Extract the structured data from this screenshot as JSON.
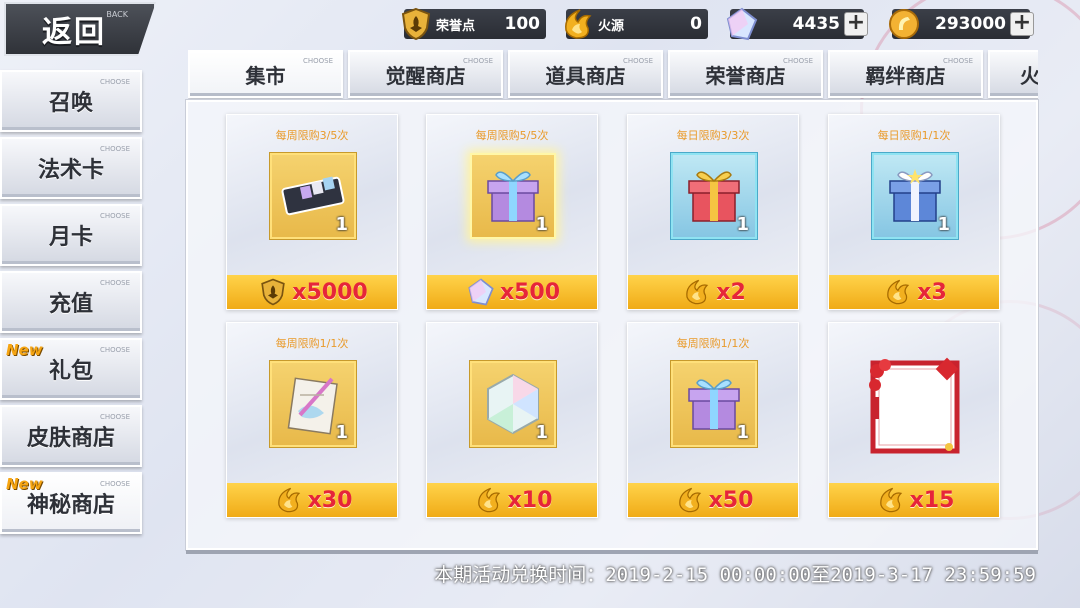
{
  "back": {
    "label": "返回",
    "sub": "BACK"
  },
  "currencies": [
    {
      "name": "荣誉点",
      "value": "100",
      "icon": "honor-badge-icon"
    },
    {
      "name": "火源",
      "value": "0",
      "icon": "fire-source-icon"
    },
    {
      "name": "",
      "value": "4435",
      "icon": "crystal-icon"
    },
    {
      "name": "",
      "value": "293000",
      "icon": "gold-coin-icon"
    }
  ],
  "sidebar": {
    "items": [
      {
        "label": "召唤",
        "tag": "CHOOSE",
        "badge": ""
      },
      {
        "label": "法术卡",
        "tag": "CHOOSE",
        "badge": ""
      },
      {
        "label": "月卡",
        "tag": "CHOOSE",
        "badge": ""
      },
      {
        "label": "充值",
        "tag": "CHOOSE",
        "badge": ""
      },
      {
        "label": "礼包",
        "tag": "CHOOSE",
        "badge": "New"
      },
      {
        "label": "皮肤商店",
        "tag": "CHOOSE",
        "badge": ""
      },
      {
        "label": "神秘商店",
        "tag": "CHOOSE",
        "badge": "New"
      }
    ]
  },
  "tabs": [
    {
      "label": "集市",
      "tag": "CHOOSE"
    },
    {
      "label": "觉醒商店",
      "tag": "CHOOSE"
    },
    {
      "label": "道具商店",
      "tag": "CHOOSE"
    },
    {
      "label": "荣誉商店",
      "tag": "CHOOSE"
    },
    {
      "label": "羁绊商店",
      "tag": "CHOOSE"
    },
    {
      "label": "火",
      "tag": ""
    }
  ],
  "items": [
    {
      "limit": "每周限购3/5次",
      "qty": "1",
      "price": "x5000",
      "currency": "honor-badge-icon",
      "icon": "card-pack-icon",
      "frame": "gold"
    },
    {
      "limit": "每周限购5/5次",
      "qty": "1",
      "price": "x500",
      "currency": "crystal-icon",
      "icon": "gift-box-purple-icon",
      "frame": "gold"
    },
    {
      "limit": "每日限购3/3次",
      "qty": "1",
      "price": "x2",
      "currency": "fire-source-icon",
      "icon": "gift-box-red-icon",
      "frame": "blue"
    },
    {
      "limit": "每日限购1/1次",
      "qty": "1",
      "price": "x3",
      "currency": "fire-source-icon",
      "icon": "gift-box-blue-icon",
      "frame": "blue"
    },
    {
      "limit": "每周限购1/1次",
      "qty": "1",
      "price": "x30",
      "currency": "fire-source-icon",
      "icon": "scroll-quill-icon",
      "frame": "gold"
    },
    {
      "limit": "",
      "qty": "1",
      "price": "x10",
      "currency": "fire-source-icon",
      "icon": "prism-crystal-icon",
      "frame": "gold"
    },
    {
      "limit": "每周限购1/1次",
      "qty": "1",
      "price": "x50",
      "currency": "fire-source-icon",
      "icon": "gift-box-purple-icon",
      "frame": "gold"
    },
    {
      "limit": "",
      "qty": "",
      "price": "x15",
      "currency": "fire-source-icon",
      "icon": "festive-frame-icon",
      "frame": "none"
    }
  ],
  "footer": {
    "text": "本期活动兑换时间：2019-2-15 00:00:00至2019-3-17 23:59:59"
  },
  "colors": {
    "accent": "#f0ab17",
    "price": "#e6253a",
    "limit": "#e99a2a"
  }
}
